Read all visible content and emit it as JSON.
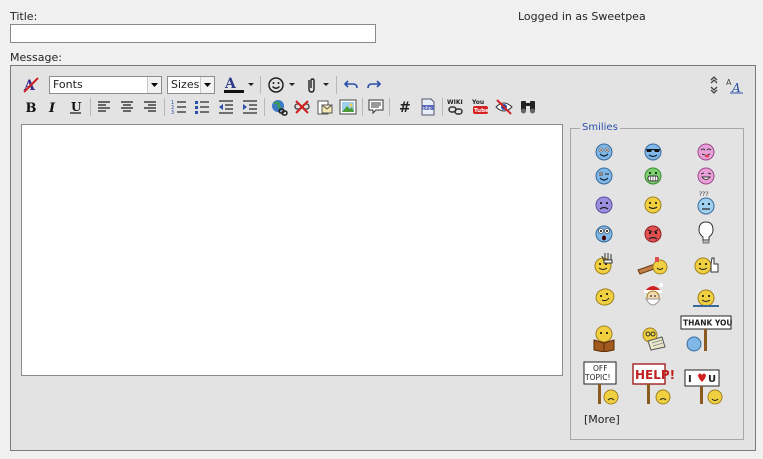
{
  "form": {
    "title_label": "Title:",
    "title_value": "",
    "message_label": "Message:",
    "login_status": "Logged in as Sweetpea"
  },
  "toolbar": {
    "font_select": "Fonts",
    "size_select": "Sizes",
    "icons": [
      "remove-format",
      "fonts-select",
      "sizes-select",
      "font-color",
      "smiley-menu",
      "attach-menu",
      "undo",
      "redo",
      "toggle-editor-size",
      "switch-editor-mode",
      "bold",
      "italic",
      "underline",
      "align-left",
      "align-center",
      "align-right",
      "ordered-list",
      "unordered-list",
      "outdent",
      "indent",
      "insert-link",
      "remove-link",
      "insert-email",
      "insert-image",
      "insert-quote",
      "insert-code",
      "insert-php",
      "insert-wiki",
      "insert-youtube",
      "spoiler",
      "find"
    ]
  },
  "smilies": {
    "legend": "Smilies",
    "more_label": "[More]",
    "items": [
      "smile",
      "cool",
      "tongue",
      "wink",
      "grin",
      "laugh",
      "sad",
      "happy",
      "confused",
      "shocked",
      "angry",
      "idea",
      "wave",
      "thumbs-up-sign",
      "thumbs-up",
      "nodding",
      "santa",
      "hi",
      "reading",
      "studying",
      "thank-you",
      "off-topic",
      "help",
      "i-love-u"
    ],
    "sign_text": {
      "thank_you": "THANK YOU!",
      "off_topic_1": "OFF",
      "off_topic_2": "TOPIC!",
      "help": "HELP!",
      "i_love_u_1": "I",
      "i_love_u_2": "U"
    }
  },
  "colors": {
    "page_bg": "#f0f0f0",
    "editor_bg": "#e3e3e3",
    "accent": "#2a4fa8",
    "smiley_blue": "#7fb8e8",
    "smiley_yellow": "#f0d040",
    "smiley_purple": "#9b8fe0",
    "smiley_red": "#e05050"
  }
}
